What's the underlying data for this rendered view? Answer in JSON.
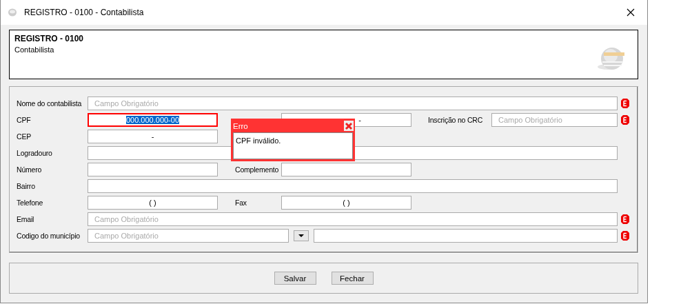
{
  "window": {
    "title": "REGISTRO - 0100 - Contabilista"
  },
  "header": {
    "title": "REGISTRO - 0100",
    "subtitle": "Contabilista"
  },
  "rows": [
    {
      "kind": "full",
      "required": true,
      "items": [
        {
          "label": "Nome do contabilista",
          "placeholder": "Campo Obrigatório"
        }
      ]
    },
    {
      "kind": "triple",
      "required": true,
      "items": [
        {
          "label": "CPF",
          "value": "000.000.000-00",
          "invalid": true,
          "highlighted": true
        },
        {
          "value": "-"
        },
        {
          "label": "Inscrição no CRC",
          "placeholder": "Campo Obrigatório"
        }
      ]
    },
    {
      "kind": "single",
      "required": false,
      "items": [
        {
          "label": "CEP",
          "value": "-"
        }
      ]
    },
    {
      "kind": "full",
      "required": false,
      "items": [
        {
          "label": "Logradouro"
        }
      ]
    },
    {
      "kind": "pair",
      "required": false,
      "items": [
        {
          "label": "Número"
        },
        {
          "label": "Complemento"
        }
      ]
    },
    {
      "kind": "full",
      "required": false,
      "items": [
        {
          "label": "Bairro"
        }
      ]
    },
    {
      "kind": "pair",
      "required": false,
      "items": [
        {
          "label": "Telefone",
          "value": "( )"
        },
        {
          "label": "Fax",
          "value": "( )"
        }
      ]
    },
    {
      "kind": "full",
      "required": true,
      "items": [
        {
          "label": "Email",
          "placeholder": "Campo Obrigatório"
        }
      ]
    },
    {
      "kind": "lookup",
      "required": true,
      "items": [
        {
          "label": "Codigo do município",
          "placeholder": "Campo Obrigatório"
        }
      ]
    }
  ],
  "popup": {
    "title": "Erro",
    "message": "CPF inválido."
  },
  "buttons": [
    "Salvar",
    "Fechar"
  ]
}
